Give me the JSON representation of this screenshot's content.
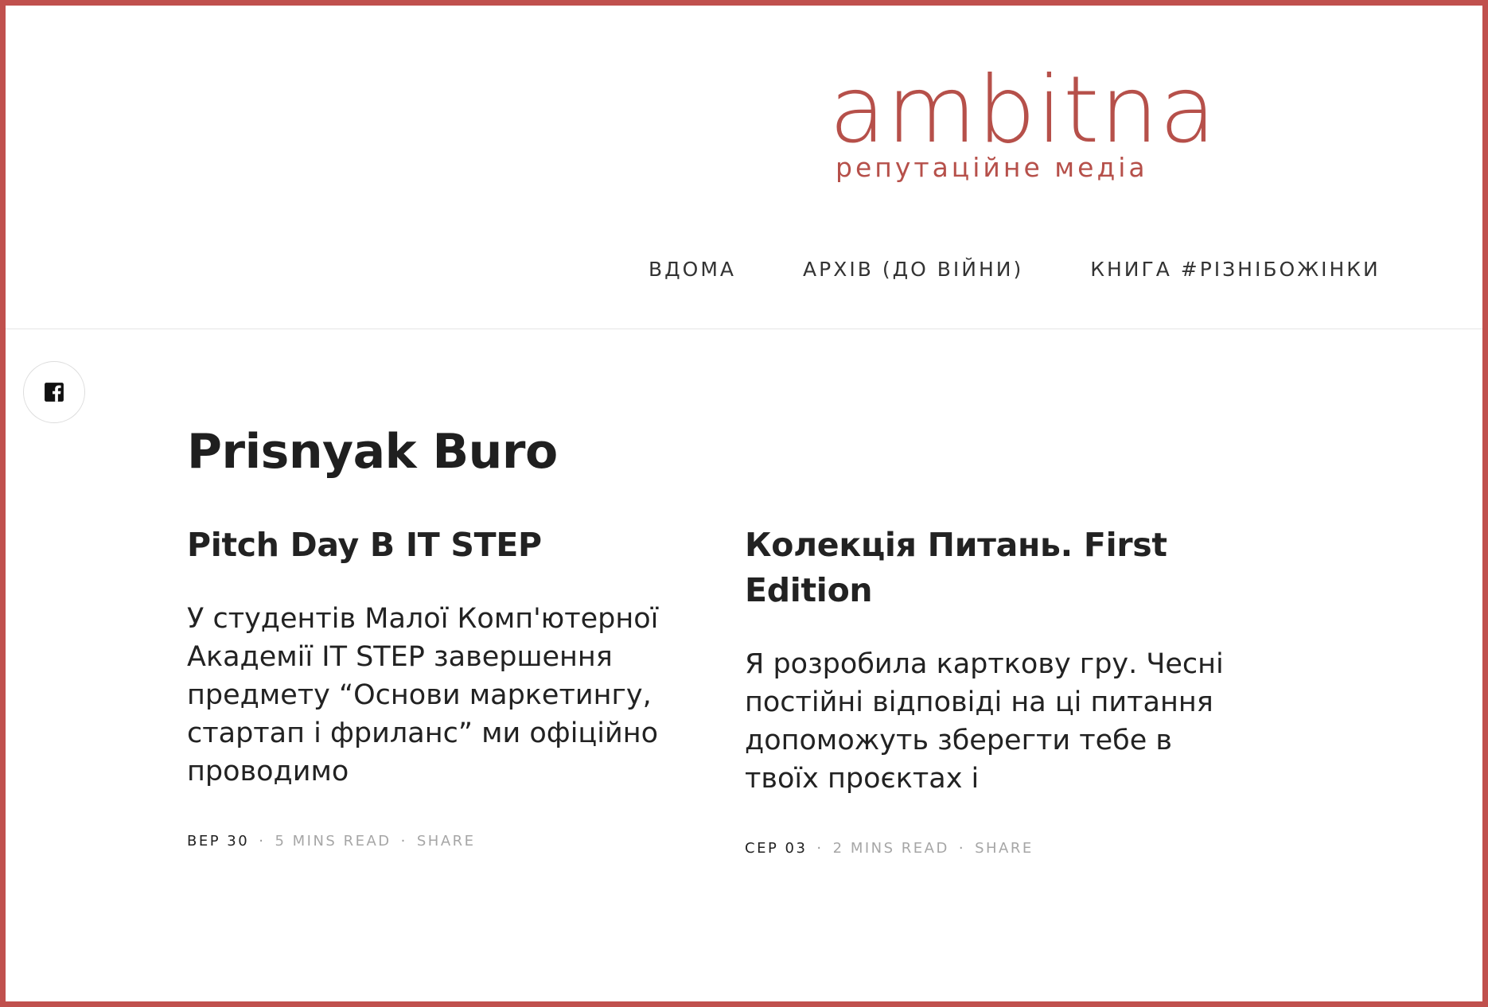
{
  "site": {
    "logo_word": "ambitna",
    "logo_tagline": "репутаційне медіа",
    "brand_color": "#b6504a",
    "frame_color": "#c0504d"
  },
  "nav": {
    "items": [
      {
        "label": "ВДОМА"
      },
      {
        "label": "АРХІВ (ДО ВІЙНИ)"
      },
      {
        "label": "КНИГА #РІЗНІБОЖІНКИ"
      }
    ]
  },
  "social": {
    "icon": "facebook-icon"
  },
  "page": {
    "title": "Prisnyak Buro"
  },
  "posts": [
    {
      "title": "Pitch Day В IT STEP",
      "excerpt": "У студентів Малої Комп'ютерної Академії IT STEP завершення предмету “Основи маркетингу, стартап і фриланс” ми офіційно проводимо",
      "date": "ВЕР 30",
      "read_time": "5 MINS READ",
      "share": "SHARE"
    },
    {
      "title": "Колекція Питань. First Edition",
      "excerpt": "Я розробила карткову гру. Чесні постійні відповіді на ці питання допоможуть зберегти тебе в твоїх проєктах і",
      "date": "СЕР 03",
      "read_time": "2 MINS READ",
      "share": "SHARE"
    }
  ]
}
